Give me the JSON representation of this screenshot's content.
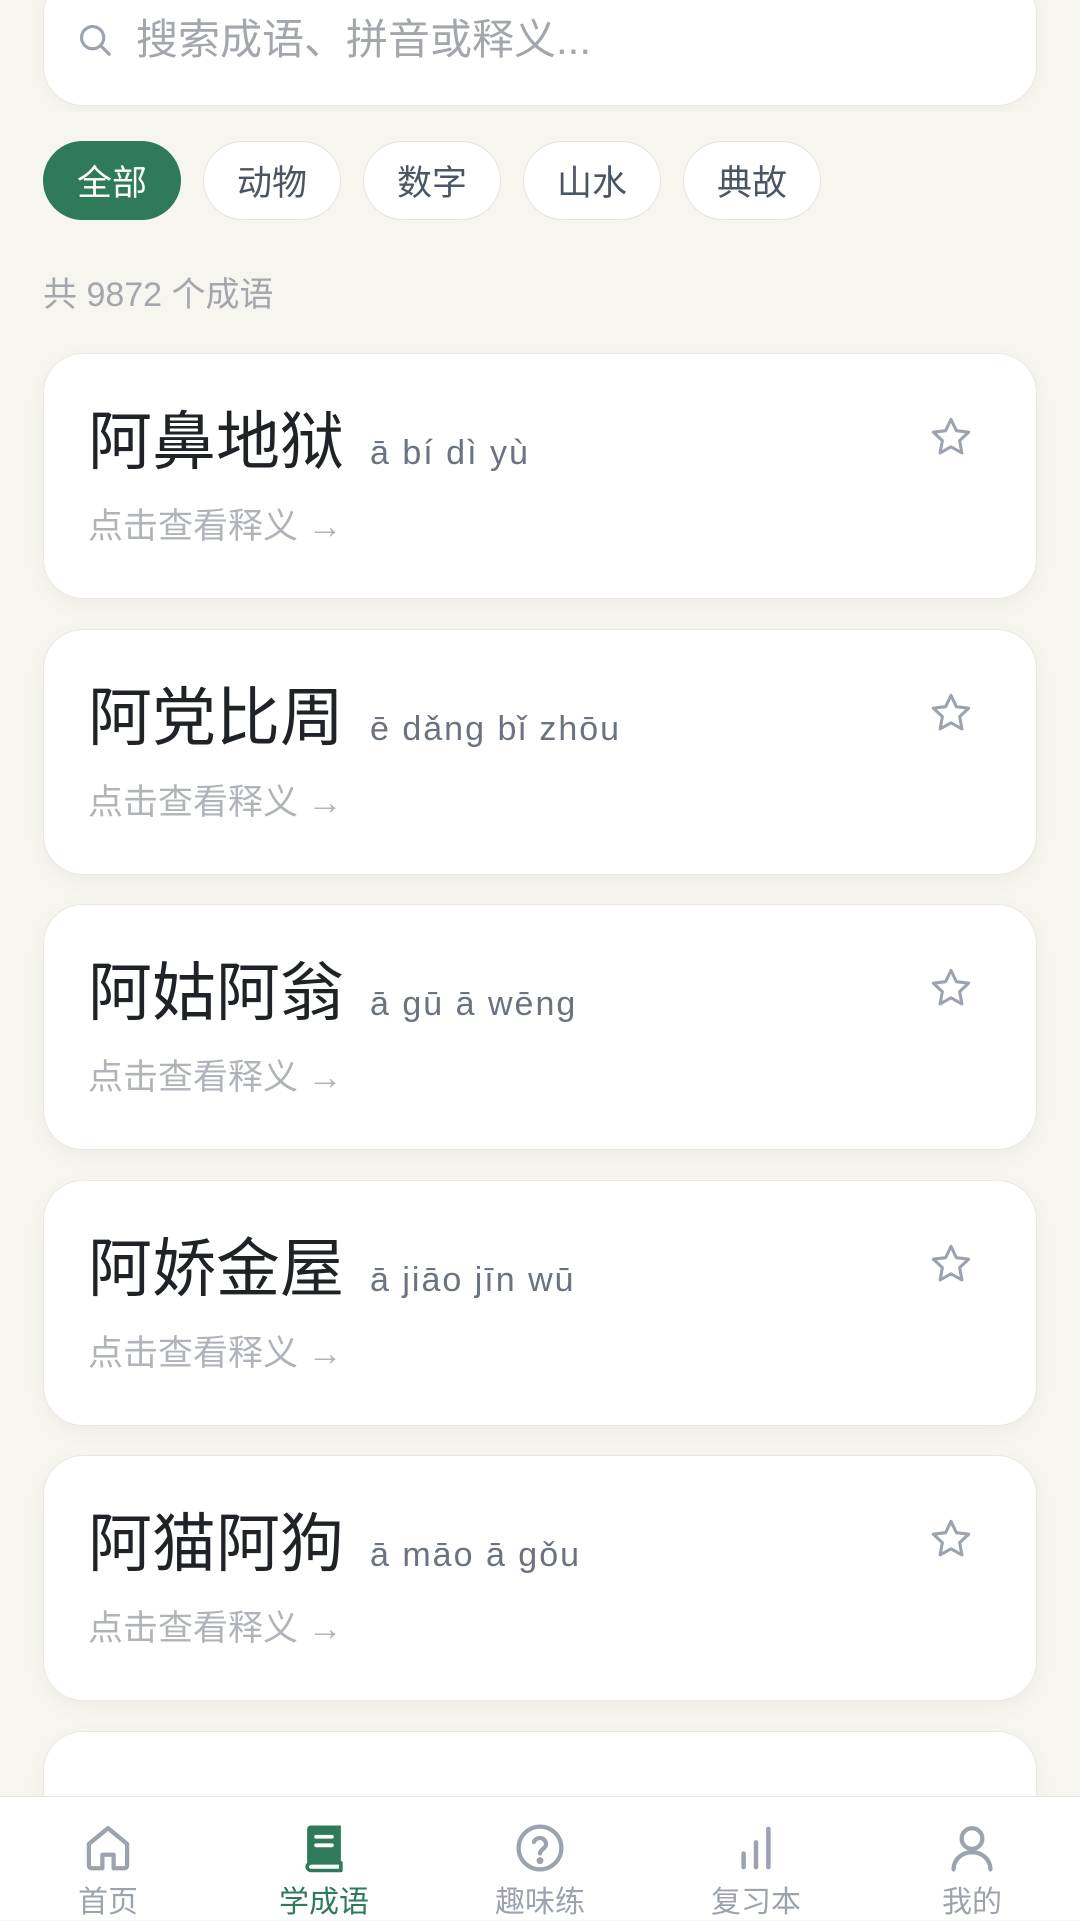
{
  "search": {
    "placeholder": "搜索成语、拼音或释义...",
    "icon": "search-icon"
  },
  "filters": [
    {
      "label": "全部",
      "active": true
    },
    {
      "label": "动物",
      "active": false
    },
    {
      "label": "数字",
      "active": false
    },
    {
      "label": "山水",
      "active": false
    },
    {
      "label": "典故",
      "active": false
    }
  ],
  "result_count": "共 9872 个成语",
  "idioms": [
    {
      "word": "阿鼻地狱",
      "pinyin": "ā bí dì yù",
      "hint": "点击查看释义 →",
      "favorited": false
    },
    {
      "word": "阿党比周",
      "pinyin": "ē dǎng bǐ zhōu",
      "hint": "点击查看释义 →",
      "favorited": false
    },
    {
      "word": "阿姑阿翁",
      "pinyin": "ā gū ā wēng",
      "hint": "点击查看释义 →",
      "favorited": false
    },
    {
      "word": "阿娇金屋",
      "pinyin": "ā jiāo jīn wū",
      "hint": "点击查看释义 →",
      "favorited": false
    },
    {
      "word": "阿猫阿狗",
      "pinyin": "ā māo ā gǒu",
      "hint": "点击查看释义 →",
      "favorited": false
    }
  ],
  "favorite_icon": "star-icon",
  "bottom_nav": [
    {
      "label": "首页",
      "icon": "home-icon",
      "active": false
    },
    {
      "label": "学成语",
      "icon": "book-icon",
      "active": true
    },
    {
      "label": "趣味练",
      "icon": "question-circle-icon",
      "active": false
    },
    {
      "label": "复习本",
      "icon": "bar-chart-icon",
      "active": false
    },
    {
      "label": "我的",
      "icon": "user-icon",
      "active": false
    }
  ],
  "colors": {
    "accent": "#2f7a58",
    "background": "#f7f5f0",
    "muted_text": "#a3a7ad",
    "icon_inactive": "#9ca3af"
  }
}
